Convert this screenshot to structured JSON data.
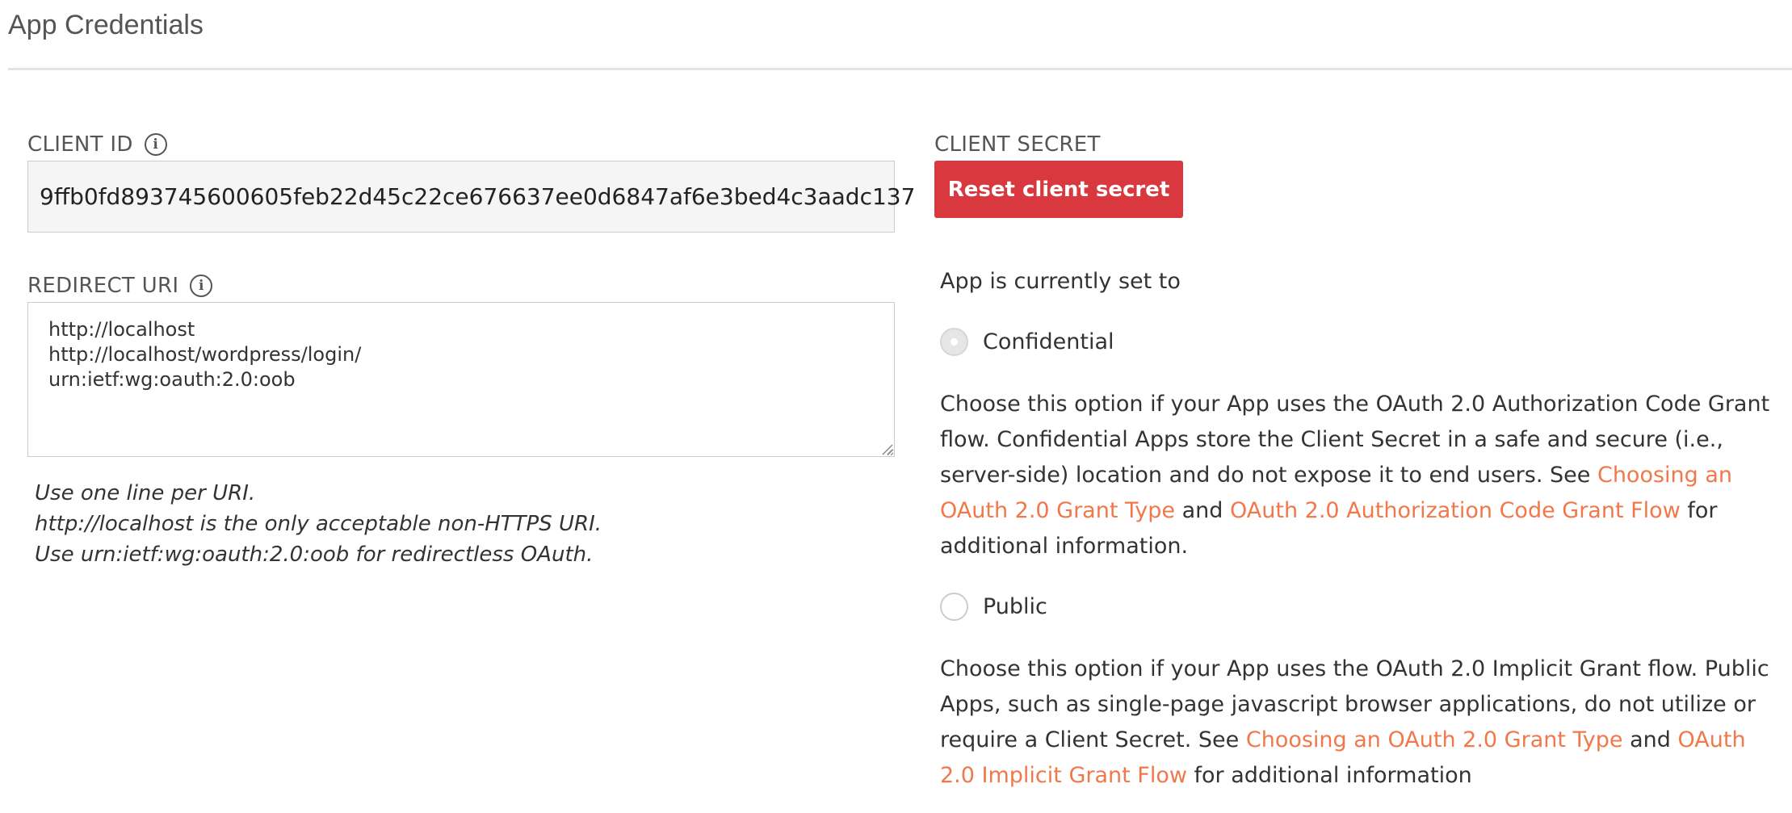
{
  "page": {
    "title": "App Credentials"
  },
  "client_id": {
    "label": "CLIENT ID",
    "value": "9ffb0fd893745600605feb22d45c22ce676637ee0d6847af6e3bed4c3aadc137",
    "info_icon": "info-icon"
  },
  "redirect_uri": {
    "label": "REDIRECT URI",
    "value": "http://localhost\nhttp://localhost/wordpress/login/\nurn:ietf:wg:oauth:2.0:oob",
    "info_icon": "info-icon",
    "hints": [
      "Use one line per URI.",
      "http://localhost is the only acceptable non-HTTPS URI.",
      "Use urn:ietf:wg:oauth:2.0:oob for redirectless OAuth."
    ]
  },
  "client_secret": {
    "label": "CLIENT SECRET",
    "reset_button": "Reset client secret"
  },
  "app_type": {
    "status_text": "App is currently set to",
    "confidential": {
      "label": "Confidential",
      "selected": true,
      "desc_1": "Choose this option if your App uses the OAuth 2.0 Authorization Code Grant flow. Confidential Apps store the Client Secret in a safe and secure (i.e., server-side) location and do not expose it to end users. See ",
      "link_1": "Choosing an OAuth 2.0 Grant Type",
      "desc_2": " and ",
      "link_2": "OAuth 2.0 Authorization Code Grant Flow",
      "desc_3": " for additional information."
    },
    "public": {
      "label": "Public",
      "selected": false,
      "desc_1": "Choose this option if your App uses the OAuth 2.0 Implicit Grant flow. Public Apps, such as single-page javascript browser applications, do not utilize or require a Client Secret. See ",
      "link_1": "Choosing an OAuth 2.0 Grant Type",
      "desc_2": " and ",
      "link_2": "OAuth 2.0 Implicit Grant Flow",
      "desc_3": " for additional information"
    }
  },
  "colors": {
    "accent_red": "#d9383e",
    "link_orange": "#f0784a",
    "text": "#333333"
  }
}
